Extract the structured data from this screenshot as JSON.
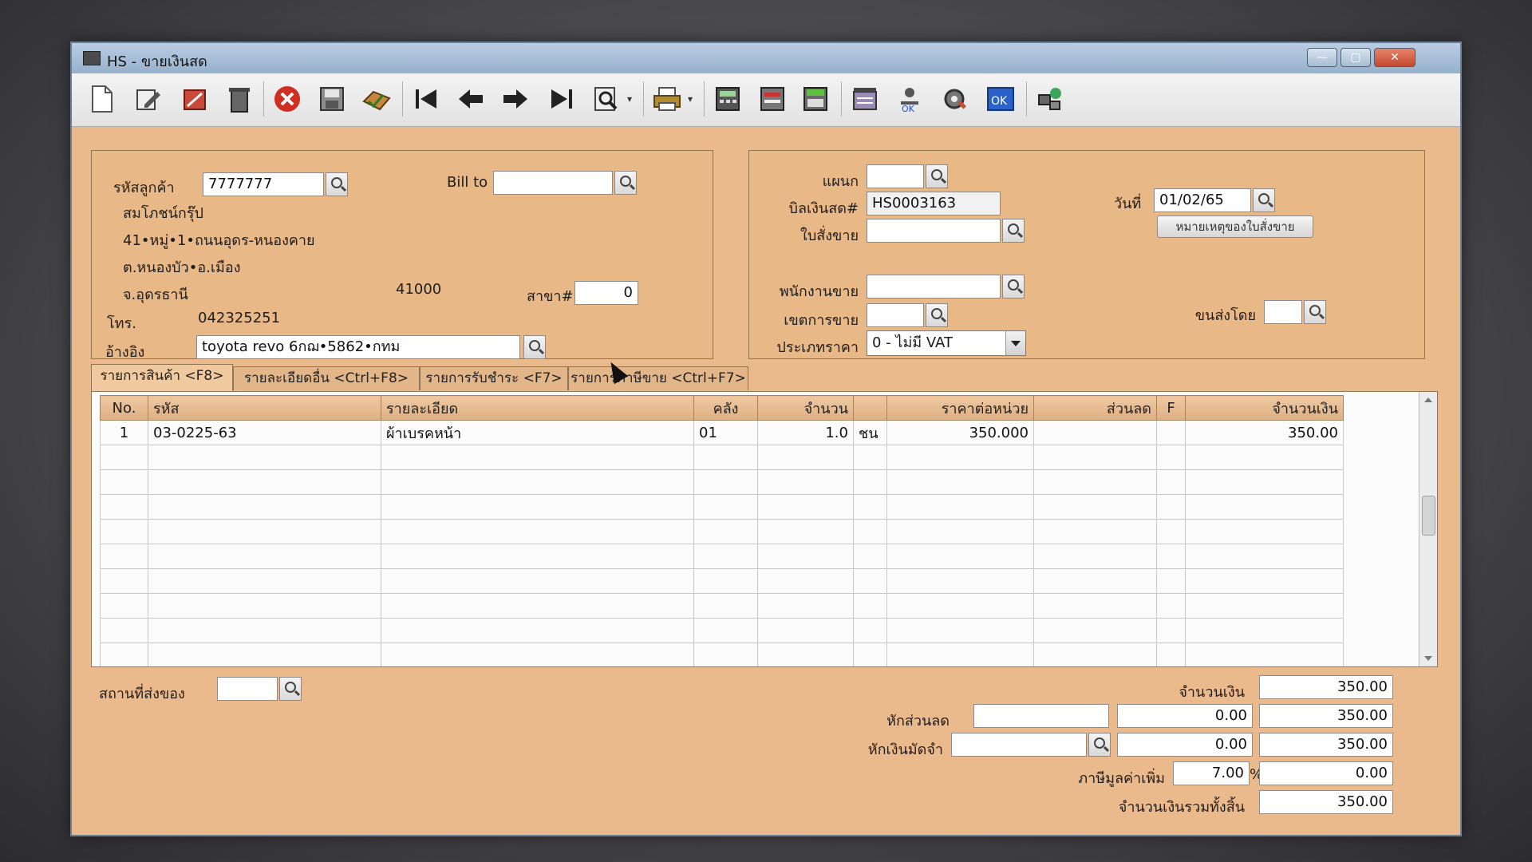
{
  "window": {
    "title": "HS - ขายเงินสด",
    "minimize": "—",
    "maximize": "▢",
    "close": "✕"
  },
  "toolbar": {
    "icons": [
      "new-document-icon",
      "edit-icon",
      "void-icon",
      "delete-icon",
      "cancel-icon",
      "save-icon",
      "approve-icon",
      "first-record-icon",
      "previous-record-icon",
      "next-record-icon",
      "last-record-icon",
      "search-record-icon",
      "print-icon",
      "calculator-icon",
      "document-list-icon",
      "inventory-icon",
      "report-icon",
      "user-ok-icon",
      "settings-icon",
      "confirm-ok-icon",
      "network-icon"
    ]
  },
  "customer": {
    "code_label": "รหัสลูกค้า",
    "code": "7777777",
    "bill_to_label": "Bill to",
    "bill_to": "",
    "name": "สมโภชน์กรุ๊ป",
    "address1": "41•หมู่•1•ถนนอุดร-หนองคาย",
    "address2": "ต.หนองบัว•อ.เมือง",
    "province": "จ.อุดรธานี",
    "postcode": "41000",
    "branch_label": "สาขา#",
    "branch": "0",
    "phone_label": "โทร.",
    "phone": "042325251",
    "reference_label": "อ้างอิง",
    "reference": "toyota revo 6กฌ•5862•กทม"
  },
  "document": {
    "department_label": "แผนก",
    "department": "",
    "bill_no_label": "บิลเงินสด#",
    "bill_no": "HS0003163",
    "date_label": "วันที่",
    "date": "01/02/65",
    "sales_order_label": "ใบสั่งขาย",
    "sales_order": "",
    "so_note_button": "หมายเหตุของใบสั่งขาย",
    "salesperson_label": "พนักงานขาย",
    "salesperson": "",
    "sales_area_label": "เขตการขาย",
    "sales_area": "",
    "ship_via_label": "ขนส่งโดย",
    "ship_via": "",
    "price_type_label": "ประเภทราคา",
    "price_type": "0 - ไม่มี VAT"
  },
  "tabs": [
    {
      "label": "รายการสินค้า <F8>"
    },
    {
      "label": "รายละเอียดอื่น <Ctrl+F8>"
    },
    {
      "label": "รายการรับชำระ <F7>"
    },
    {
      "label": "รายการภาษีขาย <Ctrl+F7>"
    }
  ],
  "grid": {
    "headers": [
      "No.",
      "รหัส",
      "รายละเอียด",
      "คลัง",
      "จำนวน",
      "",
      "ราคาต่อหน่วย",
      "ส่วนลด",
      "F",
      "จำนวนเงิน"
    ],
    "rows": [
      [
        "1",
        "03-0225-63",
        "ผ้าเบรคหน้า",
        "01",
        "1.0",
        "ชน",
        "350.000",
        "",
        "",
        "350.00"
      ]
    ]
  },
  "footer": {
    "ship_to_label": "สถานที่ส่งของ",
    "ship_to": "",
    "amount_label": "จำนวนเงิน",
    "amount": "350.00",
    "discount_label": "หักส่วนลด",
    "discount_text": "",
    "discount_value": "0.00",
    "after_discount": "350.00",
    "deposit_label": "หักเงินมัดจำ",
    "deposit_text": "",
    "deposit_value": "0.00",
    "after_deposit": "350.00",
    "vat_label": "ภาษีมูลค่าเพิ่ม",
    "vat_rate": "7.00",
    "vat_pct": "%",
    "vat_amount": "0.00",
    "total_label": "จำนวนเงินรวมทั้งสิ้น",
    "total": "350.00"
  }
}
